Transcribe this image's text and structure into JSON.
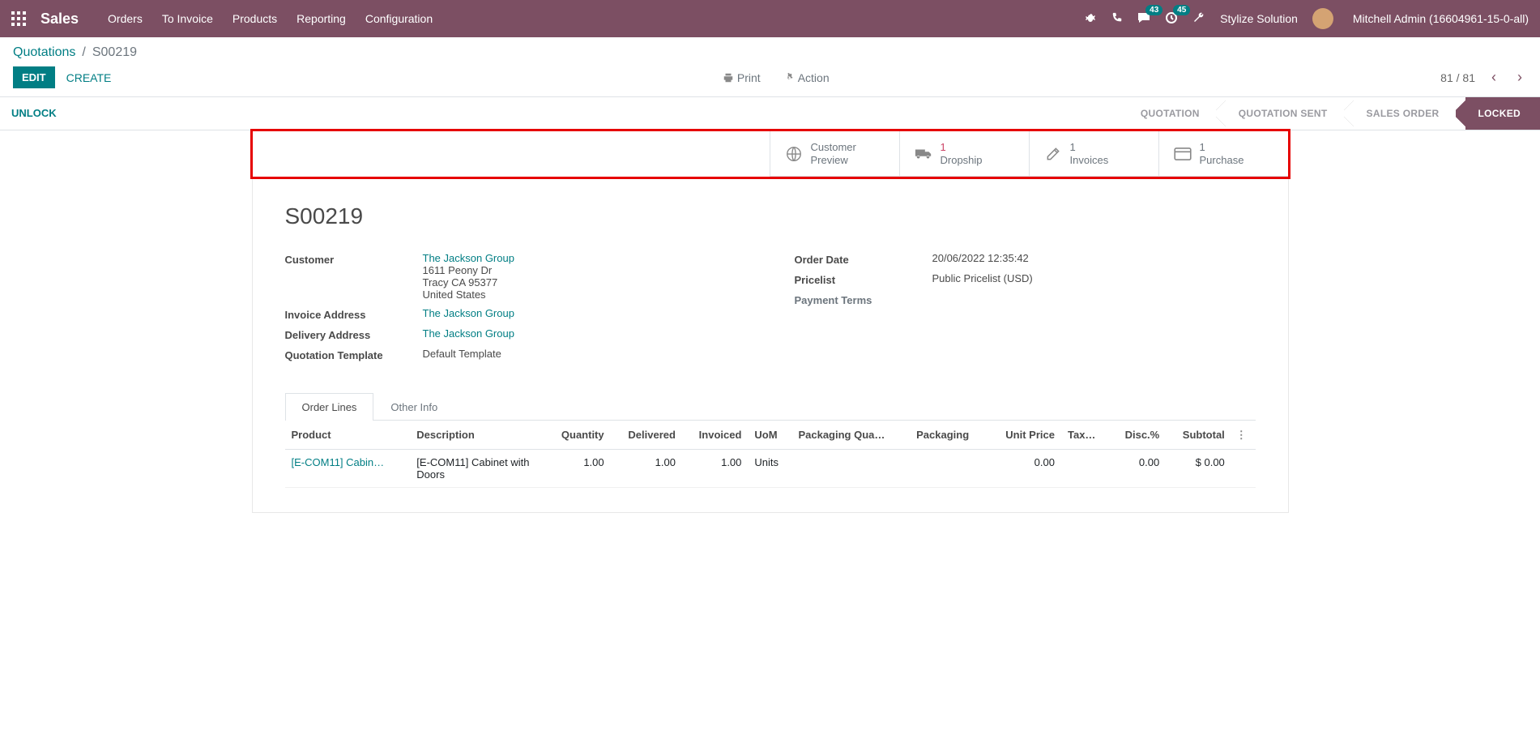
{
  "top": {
    "brand": "Sales",
    "menu": [
      "Orders",
      "To Invoice",
      "Products",
      "Reporting",
      "Configuration"
    ],
    "chat_badge": "43",
    "clock_badge": "45",
    "company": "Stylize Solution",
    "user": "Mitchell Admin (16604961-15-0-all)"
  },
  "crumb": {
    "root": "Quotations",
    "sep": "/",
    "leaf": "S00219"
  },
  "actions": {
    "edit": "EDIT",
    "create": "CREATE",
    "print": "Print",
    "action": "Action",
    "pager": "81 / 81"
  },
  "status": {
    "unlock": "UNLOCK",
    "stages": [
      "QUOTATION",
      "QUOTATION SENT",
      "SALES ORDER",
      "LOCKED"
    ]
  },
  "stats": [
    {
      "label": "Customer",
      "sub": "Preview"
    },
    {
      "count": "1",
      "label": "Dropship",
      "red": true
    },
    {
      "count": "1",
      "label": "Invoices"
    },
    {
      "count": "1",
      "label": "Purchase"
    }
  ],
  "record": {
    "title": "S00219",
    "left": [
      {
        "label": "Customer",
        "link": "The Jackson Group",
        "lines": [
          "1611 Peony Dr",
          "Tracy CA 95377",
          "United States"
        ]
      },
      {
        "label": "Invoice Address",
        "link": "The Jackson Group"
      },
      {
        "label": "Delivery Address",
        "link": "The Jackson Group"
      },
      {
        "label": "Quotation Template",
        "text": "Default Template"
      }
    ],
    "right": [
      {
        "label": "Order Date",
        "text": "20/06/2022 12:35:42"
      },
      {
        "label": "Pricelist",
        "text": "Public Pricelist (USD)"
      },
      {
        "label": "Payment Terms",
        "muted": true
      }
    ]
  },
  "tabs": [
    "Order Lines",
    "Other Info"
  ],
  "table": {
    "headers": [
      "Product",
      "Description",
      "Quantity",
      "Delivered",
      "Invoiced",
      "UoM",
      "Packaging Qua…",
      "Packaging",
      "Unit Price",
      "Tax…",
      "Disc.%",
      "Subtotal"
    ],
    "rows": [
      {
        "product": "[E-COM11] Cabin…",
        "desc": "[E-COM11] Cabinet with Doors",
        "qty": "1.00",
        "del": "1.00",
        "inv": "1.00",
        "uom": "Units",
        "pqty": "",
        "pkg": "",
        "price": "0.00",
        "tax": "",
        "disc": "0.00",
        "sub": "$ 0.00"
      }
    ]
  }
}
